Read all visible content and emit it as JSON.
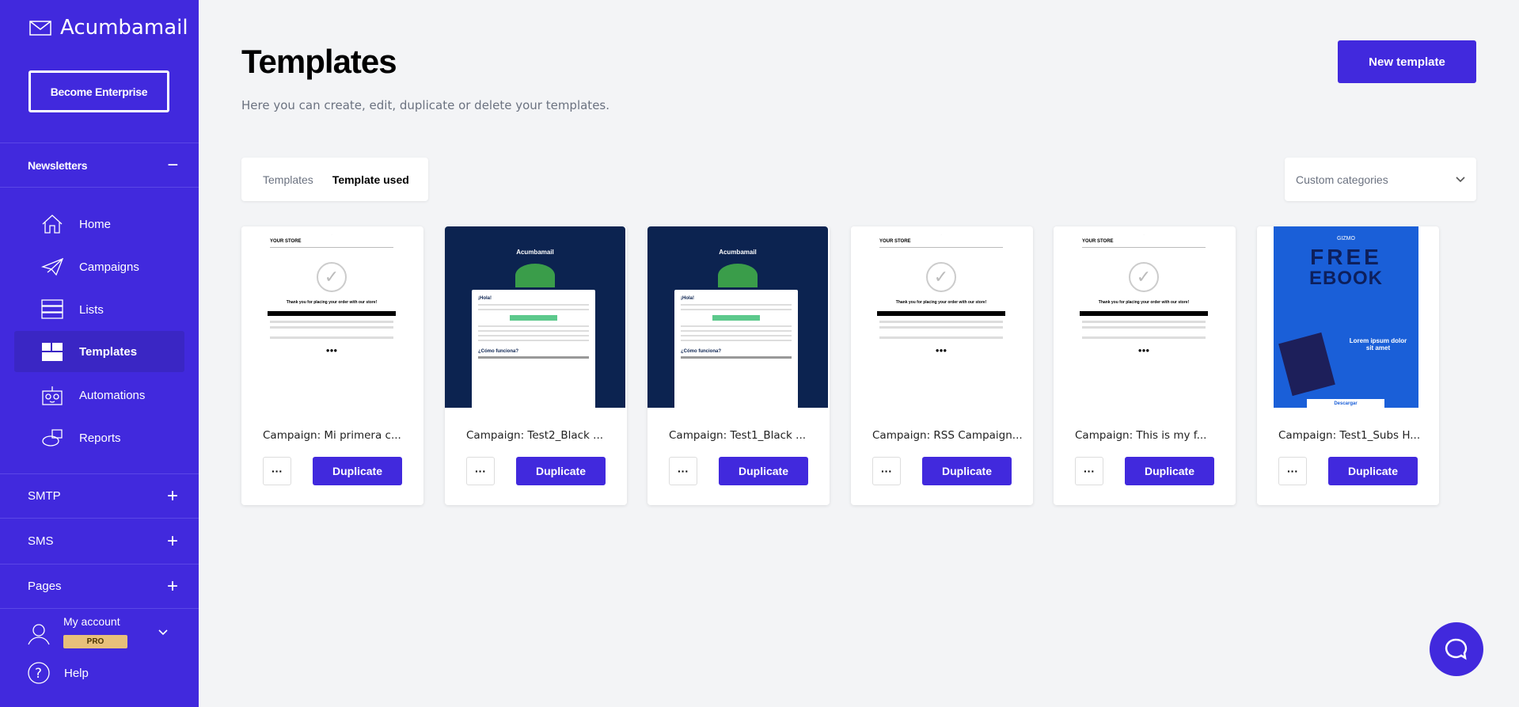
{
  "brand": {
    "name": "Acumbamail",
    "accent": "#4129dd"
  },
  "sidebar": {
    "enterprise_label": "Become Enterprise",
    "newsletters": {
      "label": "Newsletters",
      "toggle": "−"
    },
    "items": [
      {
        "label": "Home",
        "icon": "home-icon"
      },
      {
        "label": "Campaigns",
        "icon": "paper-plane-icon"
      },
      {
        "label": "Lists",
        "icon": "list-icon"
      },
      {
        "label": "Templates",
        "icon": "templates-icon",
        "active": true
      },
      {
        "label": "Automations",
        "icon": "robot-icon"
      },
      {
        "label": "Reports",
        "icon": "pie-chart-icon"
      }
    ],
    "sections": [
      {
        "label": "SMTP",
        "toggle": "+"
      },
      {
        "label": "SMS",
        "toggle": "+"
      },
      {
        "label": "Pages",
        "toggle": "+"
      }
    ],
    "account": {
      "label": "My account",
      "badge": "PRO",
      "badge_color": "#e8c07a"
    },
    "help": "Help"
  },
  "header": {
    "title": "Templates",
    "subtitle": "Here you can create, edit, duplicate or delete your templates.",
    "new_button": "New template"
  },
  "tabs": [
    {
      "label": "Templates"
    },
    {
      "label": "Template used",
      "active": true
    }
  ],
  "filter": {
    "placeholder": "Custom categories"
  },
  "cards": [
    {
      "title": "Campaign: Mi primera c...",
      "thumb": "store",
      "dots": "···",
      "button": "Duplicate"
    },
    {
      "title": "Campaign: Test2_Black ...",
      "thumb": "acumbamail",
      "thumb_text": {
        "logo": "Acumbamail",
        "hello": "¡Hola!",
        "section": "¿Cómo funciona?"
      },
      "dots": "···",
      "button": "Duplicate"
    },
    {
      "title": "Campaign: Test1_Black ...",
      "thumb": "acumbamail",
      "thumb_text": {
        "logo": "Acumbamail",
        "hello": "¡Hola!",
        "section": "¿Cómo funciona?"
      },
      "dots": "···",
      "button": "Duplicate"
    },
    {
      "title": "Campaign: RSS Campaign...",
      "thumb": "store",
      "dots": "···",
      "button": "Duplicate"
    },
    {
      "title": "Campaign: This is my f...",
      "thumb": "store",
      "dots": "···",
      "button": "Duplicate"
    },
    {
      "title": "Campaign: Test1_Subs H...",
      "thumb": "ebook",
      "thumb_text": {
        "logo": "GIZMO",
        "headline1": "FREE",
        "headline2": "EBOOK",
        "lorem": "Lorem ipsum dolor sit amet",
        "cta": "Descargar"
      },
      "dots": "···",
      "button": "Duplicate"
    }
  ],
  "store_thumb": {
    "store": "YOUR STORE",
    "thanks": "Thank you for placing your order with our store!"
  }
}
